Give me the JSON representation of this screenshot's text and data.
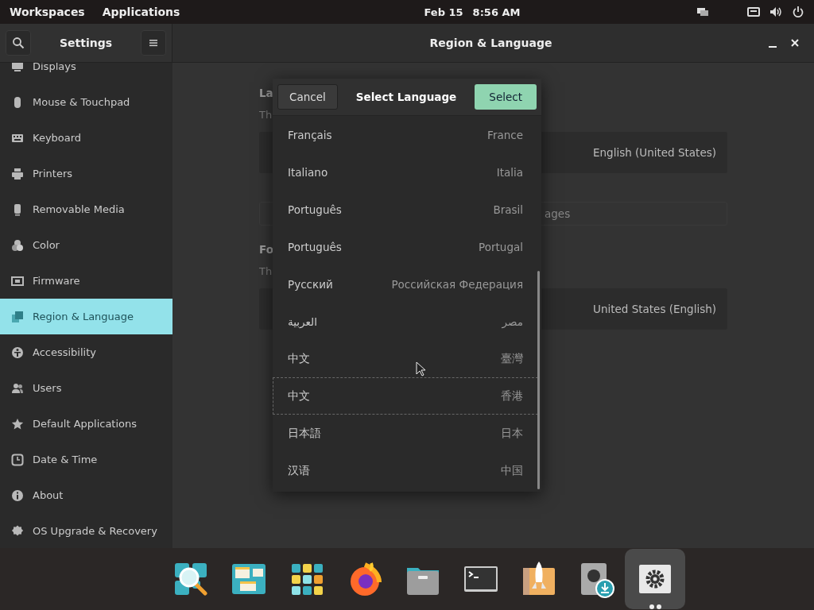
{
  "top_bar": {
    "workspaces": "Workspaces",
    "applications": "Applications",
    "date": "Feb 15",
    "time": "8:56 AM",
    "tray": [
      {
        "kind": "display"
      },
      {
        "kind": "keyboard"
      },
      {
        "kind": "volume"
      },
      {
        "kind": "power"
      }
    ]
  },
  "sidebar": {
    "title": "Settings",
    "items": [
      {
        "label": "Displays",
        "kind": "display",
        "selected": false
      },
      {
        "label": "Mouse & Touchpad",
        "kind": "mouse",
        "selected": false
      },
      {
        "label": "Keyboard",
        "kind": "keyboard",
        "selected": false
      },
      {
        "label": "Printers",
        "kind": "printer",
        "selected": false
      },
      {
        "label": "Removable Media",
        "kind": "media",
        "selected": false
      },
      {
        "label": "Color",
        "kind": "color",
        "selected": false
      },
      {
        "label": "Firmware",
        "kind": "firmware",
        "selected": false
      },
      {
        "label": "Region & Language",
        "kind": "region",
        "selected": true
      },
      {
        "label": "Accessibility",
        "kind": "accessibility",
        "selected": false
      },
      {
        "label": "Users",
        "kind": "users",
        "selected": false
      },
      {
        "label": "Default Applications",
        "kind": "star",
        "selected": false
      },
      {
        "label": "Date & Time",
        "kind": "clock",
        "selected": false
      },
      {
        "label": "About",
        "kind": "info",
        "selected": false
      },
      {
        "label": "OS Upgrade & Recovery",
        "kind": "upgrade",
        "selected": false
      }
    ]
  },
  "content": {
    "title": "Region & Language",
    "language_heading": "La",
    "language_hint": "Th",
    "language_value": "English (United States)",
    "more_languages": "ages",
    "formats_heading": "Fo",
    "formats_hint": "Th",
    "formats_value": "United States (English)"
  },
  "dialog": {
    "title": "Select Language",
    "cancel": "Cancel",
    "select": "Select",
    "languages": [
      {
        "name": "Français",
        "region": "France",
        "focused": false
      },
      {
        "name": "Italiano",
        "region": "Italia",
        "focused": false
      },
      {
        "name": "Português",
        "region": "Brasil",
        "focused": false
      },
      {
        "name": "Português",
        "region": "Portugal",
        "focused": false
      },
      {
        "name": "Русский",
        "region": "Российская Федерация",
        "focused": false
      },
      {
        "name": "العربية",
        "region": "مصر",
        "focused": false
      },
      {
        "name": "中文",
        "region": "臺灣",
        "focused": false
      },
      {
        "name": "中文",
        "region": "香港",
        "focused": true
      },
      {
        "name": "日本語",
        "region": "日本",
        "focused": false
      },
      {
        "name": "汉语",
        "region": "中国",
        "focused": false
      }
    ]
  },
  "dock": {
    "apps": [
      {
        "kind": "search",
        "running": false,
        "selected": false
      },
      {
        "kind": "multitasking",
        "running": false,
        "selected": false
      },
      {
        "kind": "apps",
        "running": false,
        "selected": false
      },
      {
        "kind": "browser",
        "running": false,
        "selected": false
      },
      {
        "kind": "files",
        "running": false,
        "selected": false
      },
      {
        "kind": "terminal",
        "running": false,
        "selected": false
      },
      {
        "kind": "launcher",
        "running": false,
        "selected": false
      },
      {
        "kind": "installer",
        "running": false,
        "selected": false
      },
      {
        "kind": "settings",
        "running": true,
        "selected": true
      }
    ]
  }
}
